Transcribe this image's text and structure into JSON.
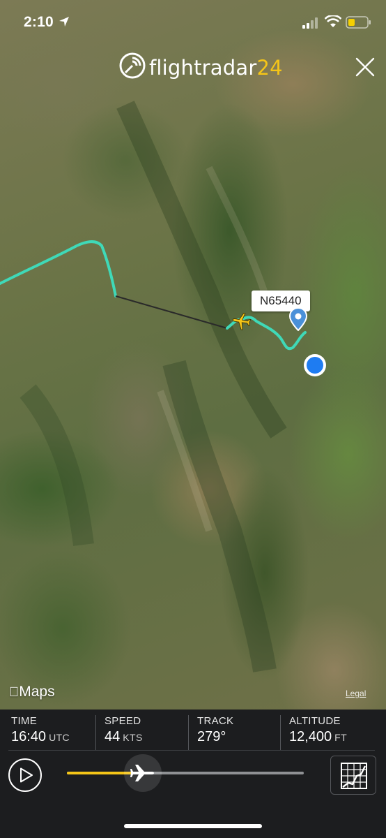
{
  "status_bar": {
    "time": "2:10",
    "battery_color": "#f5d000"
  },
  "header": {
    "logo_main": "flightradar",
    "logo_accent": "24",
    "accent_color": "#f5c518"
  },
  "map": {
    "aircraft_label": "N65440",
    "track_color": "#3fd9b8",
    "attribution": "Maps",
    "legal_link": "Legal"
  },
  "stats": [
    {
      "label": "TIME",
      "value": "16:40",
      "unit": "UTC"
    },
    {
      "label": "SPEED",
      "value": "44",
      "unit": "KTS"
    },
    {
      "label": "TRACK",
      "value": "279°",
      "unit": ""
    },
    {
      "label": "ALTITUDE",
      "value": "12,400",
      "unit": "FT"
    }
  ],
  "playback": {
    "progress": 0.32,
    "accent_color": "#f5c518"
  }
}
